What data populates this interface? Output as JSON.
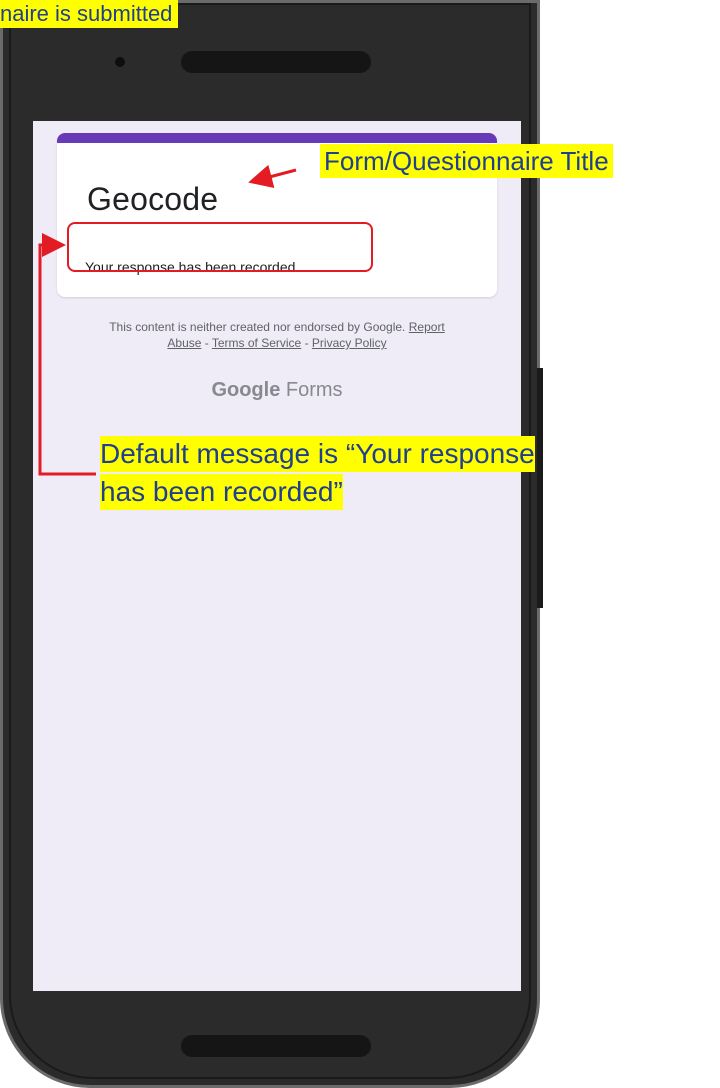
{
  "annotations": {
    "top_caption": "naire is submitted",
    "title_caption": "Form/Questionnaire Title",
    "message_caption_line1": "Default message is “Your response",
    "message_caption_line2": "has been recorded”"
  },
  "form": {
    "title": "Geocode",
    "response_message": "Your response has been recorded.",
    "accent_color": "#673ab7"
  },
  "footer": {
    "disclaimer": "This content is neither created nor endorsed by Google.",
    "report_link": "Report",
    "abuse_link": "Abuse",
    "separator": " - ",
    "terms_link": "Terms of Service",
    "privacy_link": "Privacy Policy"
  },
  "brand": {
    "name_bold": "Google",
    "name_regular": " Forms"
  },
  "colors": {
    "screen_bg": "#efebf7",
    "highlight": "#ffff00",
    "annotation_red": "#e31b23"
  }
}
